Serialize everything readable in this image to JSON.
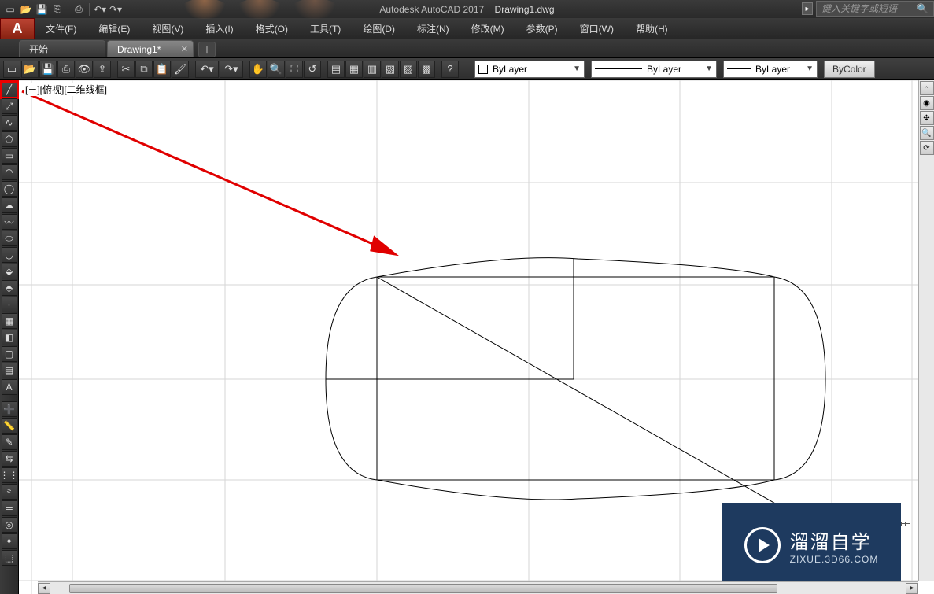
{
  "title": {
    "app": "Autodesk AutoCAD 2017",
    "doc": "Drawing1.dwg"
  },
  "search_placeholder": "键入关键字或短语",
  "menus": [
    "文件(F)",
    "编辑(E)",
    "视图(V)",
    "插入(I)",
    "格式(O)",
    "工具(T)",
    "绘图(D)",
    "标注(N)",
    "修改(M)",
    "参数(P)",
    "窗口(W)",
    "帮助(H)"
  ],
  "tabs": {
    "start": "开始",
    "current": "Drawing1*"
  },
  "layer": {
    "color": "ByLayer",
    "linetype": "ByLayer",
    "lineweight": "ByLayer",
    "bycolor": "ByColor"
  },
  "viewport_label": "[－][俯视][二维线框]",
  "watermark": {
    "big": "溜溜自学",
    "small": "ZIXUE.3D66.COM"
  },
  "qat_icons": [
    "new-icon",
    "open-icon",
    "save-icon",
    "saveas-icon",
    "plot-icon",
    "undo-icon",
    "redo-icon"
  ],
  "toolbar_icons": [
    "new-icon",
    "open-icon",
    "save-icon",
    "plot-icon",
    "plot-preview-icon",
    "publish-icon",
    "cut-icon",
    "copy-icon",
    "paste-icon",
    "match-icon",
    "undo-icon",
    "redo-icon",
    "pan-icon",
    "zoom-extents-icon",
    "zoom-window-icon",
    "zoom-prev-icon",
    "properties-icon",
    "design-center-icon",
    "tool-palettes-icon",
    "sheet-icon",
    "markup-icon",
    "qcalc-icon",
    "help-icon"
  ],
  "left_tools": [
    "line-tool",
    "construction-line-tool",
    "polyline-tool",
    "polygon-tool",
    "rectangle-tool",
    "arc-tool",
    "circle-tool",
    "revision-cloud-tool",
    "spline-tool",
    "ellipse-tool",
    "ellipse-arc-tool",
    "insert-block-tool",
    "make-block-tool",
    "point-tool",
    "hatch-tool",
    "gradient-tool",
    "region-tool",
    "table-tool",
    "text-tool",
    "addselected-tool",
    "measure-tool",
    "sketch-tool",
    "align-tool",
    "array-tool",
    "polyline-edit-tool",
    "multiline-tool",
    "donut-tool",
    "point-style-tool",
    "wipeout-tool"
  ]
}
